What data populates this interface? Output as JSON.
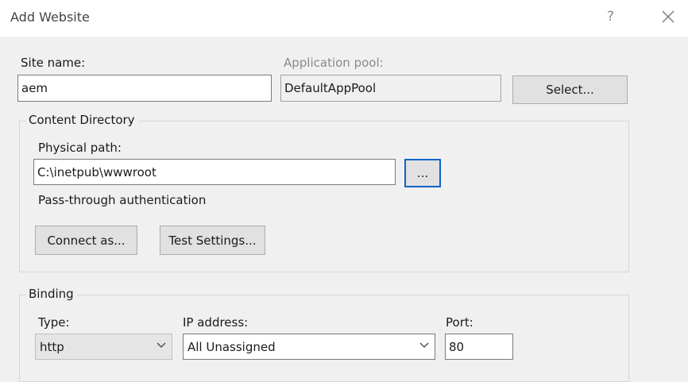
{
  "window": {
    "title": "Add Website",
    "help_label": "?"
  },
  "site": {
    "name_label": "Site name:",
    "name_value": "aem"
  },
  "app_pool": {
    "label": "Application pool:",
    "value": "DefaultAppPool",
    "select_label": "Select..."
  },
  "content_directory": {
    "title": "Content Directory",
    "physical_path_label": "Physical path:",
    "physical_path_value": "C:\\inetpub\\wwwroot",
    "browse_label": "...",
    "pass_through_label": "Pass-through authentication",
    "connect_as_label": "Connect as...",
    "test_settings_label": "Test Settings..."
  },
  "binding": {
    "title": "Binding",
    "type_label": "Type:",
    "type_value": "http",
    "ip_label": "IP address:",
    "ip_value": "All Unassigned",
    "port_label": "Port:",
    "port_value": "80"
  },
  "icons": {
    "close": "close-icon",
    "dropdown": "chevron-down-icon"
  },
  "colors": {
    "focus_border": "#0a64c8",
    "title_bg": "#ffffff",
    "dialog_bg": "#f0f0f0"
  }
}
